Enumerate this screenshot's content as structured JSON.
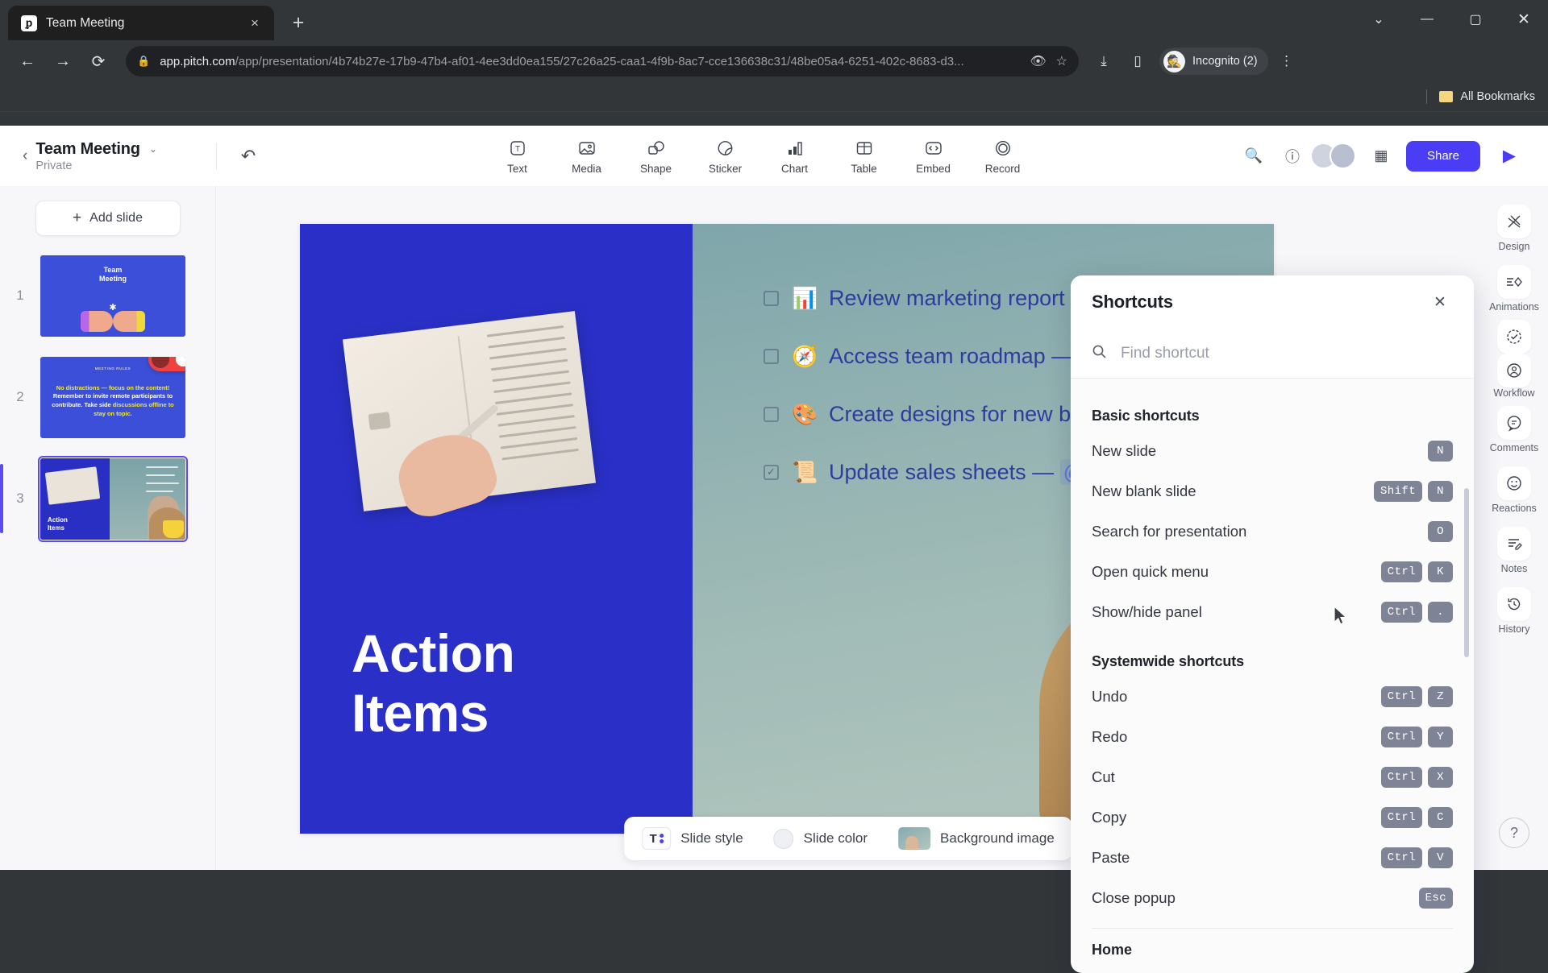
{
  "browser": {
    "tab": {
      "title": "Team Meeting",
      "favicon_name": "pitch-favicon",
      "close_label": "×"
    },
    "new_tab_label": "+",
    "window_controls": {
      "minimize": "—",
      "maximize": "▢",
      "close": "✕",
      "chevron": "⌄"
    },
    "nav": {
      "back": "←",
      "forward": "→",
      "reload": "⟳"
    },
    "omnibox": {
      "lock": "🔒",
      "url_domain": "app.pitch.com",
      "url_path": "/app/presentation/4b74b27e-17b9-47b4-af01-4ee3dd0ea155/27c26a25-caa1-4f9b-8ac7-cce136638c31/48be05a4-6251-402c-8683-d3...",
      "eye_icon": "👁",
      "star_icon": "☆"
    },
    "toolbar_icons": {
      "download": "⤓",
      "side_panel": "▯",
      "menu": "⋮"
    },
    "profile": {
      "label": "Incognito (2)",
      "icon": "🕵"
    },
    "bookmarks": {
      "label": "All Bookmarks"
    }
  },
  "app": {
    "deck": {
      "title": "Team Meeting",
      "privacy": "Private",
      "caret": "⌄",
      "back_chevron": "‹"
    },
    "undo_label": "undo",
    "insert_tools": [
      {
        "label": "Text",
        "icon": "text-icon"
      },
      {
        "label": "Media",
        "icon": "media-icon"
      },
      {
        "label": "Shape",
        "icon": "shape-icon"
      },
      {
        "label": "Sticker",
        "icon": "sticker-icon"
      },
      {
        "label": "Chart",
        "icon": "chart-icon"
      },
      {
        "label": "Table",
        "icon": "table-icon"
      },
      {
        "label": "Embed",
        "icon": "embed-icon"
      },
      {
        "label": "Record",
        "icon": "record-icon"
      }
    ],
    "share_label": "Share",
    "play_label": "▶",
    "add_slide_label": "Add slide",
    "add_slide_plus": "+",
    "slides": [
      {
        "number": "1",
        "title_line1": "Team",
        "title_line2": "Meeting"
      },
      {
        "number": "2",
        "eyebrow": "MEETING RULES",
        "body_yellow_1": "No distractions — focus on the content!",
        "body_white": "Remember to invite remote participants to contribute. Take side",
        "body_yellow_2": "discussions offline to",
        "body_yellow_3": "stay on topic."
      },
      {
        "number": "3",
        "title_line1": "Action",
        "title_line2": "Items"
      }
    ],
    "slide": {
      "title_line1": "Action",
      "title_line2": "Items",
      "tasks": [
        {
          "checked": false,
          "emoji": "📊",
          "text": "Review marketing report —",
          "mention": ""
        },
        {
          "checked": false,
          "emoji": "🧭",
          "text": "Access team roadmap —",
          "mention": "@"
        },
        {
          "checked": false,
          "emoji": "🎨",
          "text": "Create designs for new bann",
          "mention": ""
        },
        {
          "checked": true,
          "emoji": "📜",
          "text": "Update sales sheets —",
          "mention": "@Ja"
        }
      ]
    },
    "bottom_bar": [
      {
        "label": "Slide style",
        "icon": "slide-style-icon"
      },
      {
        "label": "Slide color",
        "icon": "slide-color-icon"
      },
      {
        "label": "Background image",
        "icon": "background-image-icon"
      }
    ],
    "right_rail": [
      {
        "label": "Design",
        "icon": "design-icon"
      },
      {
        "label": "Animations",
        "icon": "animations-icon"
      },
      {
        "label": "Workflow",
        "icon": "workflow-icon"
      },
      {
        "label": "Comments",
        "icon": "comments-icon"
      },
      {
        "label": "Reactions",
        "icon": "reactions-icon"
      },
      {
        "label": "Notes",
        "icon": "notes-icon"
      },
      {
        "label": "History",
        "icon": "history-icon"
      }
    ],
    "help_label": "?"
  },
  "shortcuts_panel": {
    "title": "Shortcuts",
    "close": "✕",
    "search_placeholder": "Find shortcut",
    "search_icon": "search-icon",
    "sections": [
      {
        "heading": "Basic shortcuts",
        "rows": [
          {
            "label": "New slide",
            "keys": [
              "N"
            ]
          },
          {
            "label": "New blank slide",
            "keys": [
              "Shift",
              "N"
            ]
          },
          {
            "label": "Search for presentation",
            "keys": [
              "O"
            ]
          },
          {
            "label": "Open quick menu",
            "keys": [
              "Ctrl",
              "K"
            ]
          },
          {
            "label": "Show/hide panel",
            "keys": [
              "Ctrl",
              "."
            ]
          }
        ]
      },
      {
        "heading": "Systemwide shortcuts",
        "rows": [
          {
            "label": "Undo",
            "keys": [
              "Ctrl",
              "Z"
            ]
          },
          {
            "label": "Redo",
            "keys": [
              "Ctrl",
              "Y"
            ]
          },
          {
            "label": "Cut",
            "keys": [
              "Ctrl",
              "X"
            ]
          },
          {
            "label": "Copy",
            "keys": [
              "Ctrl",
              "C"
            ]
          },
          {
            "label": "Paste",
            "keys": [
              "Ctrl",
              "V"
            ]
          },
          {
            "label": "Close popup",
            "keys": [
              "Esc"
            ]
          }
        ]
      }
    ],
    "trailing_heading": "Home"
  }
}
